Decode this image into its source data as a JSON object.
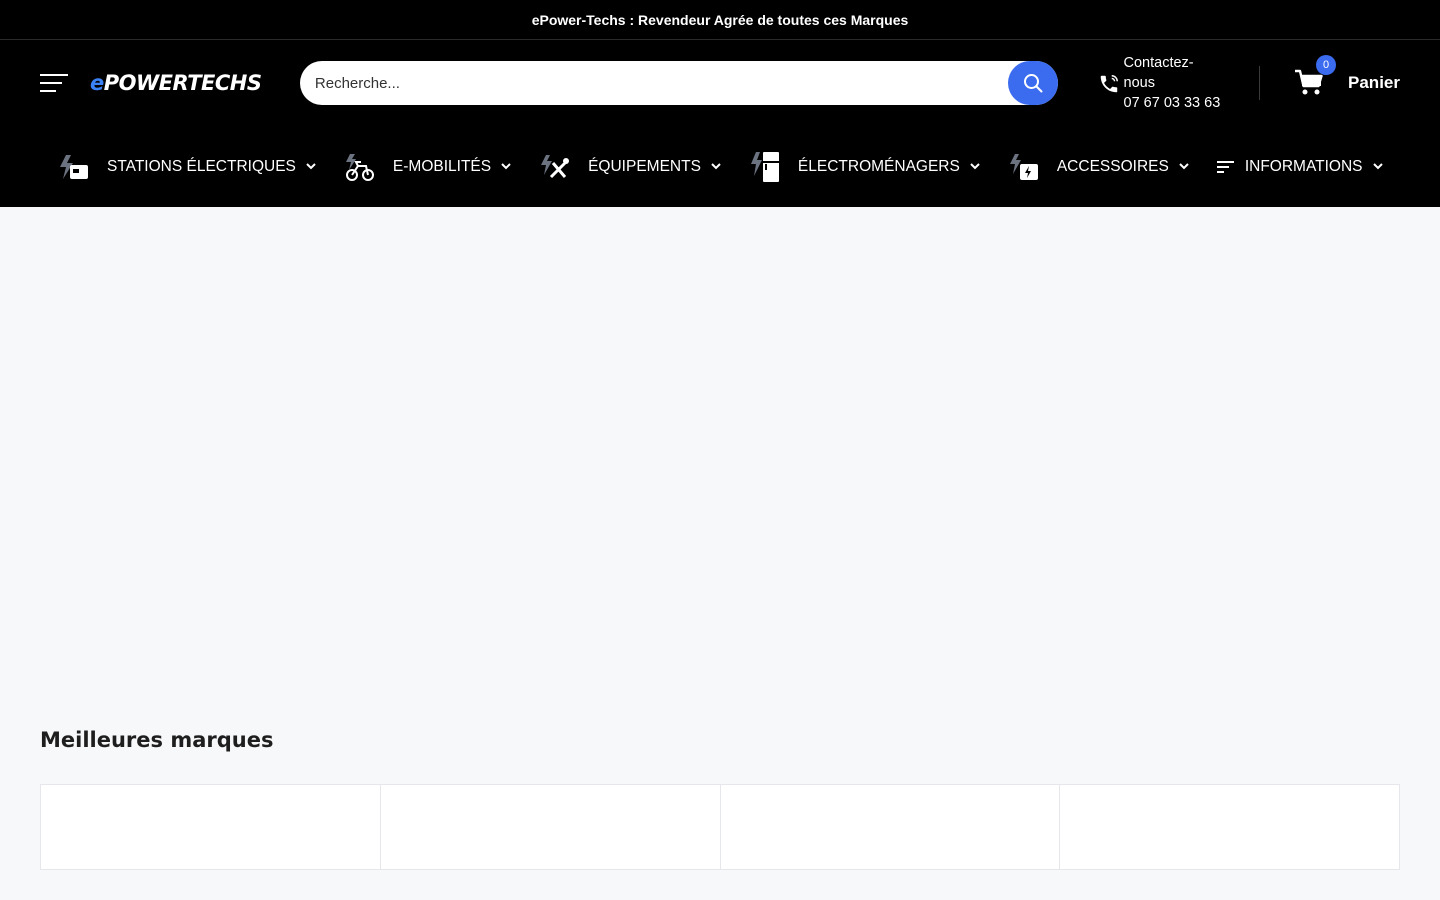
{
  "announcement": {
    "text": "ePower-Techs : Revendeur Agrée de toutes ces Marques"
  },
  "header": {
    "logo_text_e": "e",
    "logo_text_rest": "POWERTECHS",
    "search_placeholder": "Recherche...",
    "contact_label": "Contactez-nous",
    "contact_phone": "07 67 03 33 63",
    "cart_count": "0",
    "cart_label": "Panier"
  },
  "nav": {
    "items": [
      {
        "label": "STATIONS ÉLECTRIQUES",
        "icon": "power-station-icon"
      },
      {
        "label": "E-MOBILITÉS",
        "icon": "bike-icon"
      },
      {
        "label": "ÉQUIPEMENTS",
        "icon": "tools-icon"
      },
      {
        "label": "ÉLECTROMÉNAGERS",
        "icon": "fridge-icon"
      },
      {
        "label": "ACCESSOIRES",
        "icon": "battery-icon"
      },
      {
        "label": "INFORMATIONS",
        "icon": "list-icon"
      }
    ]
  },
  "brands": {
    "title": "Meilleures marques"
  },
  "colors": {
    "accent": "#3b6cf0",
    "header_bg": "#000000",
    "page_bg": "#f7f8fa"
  }
}
